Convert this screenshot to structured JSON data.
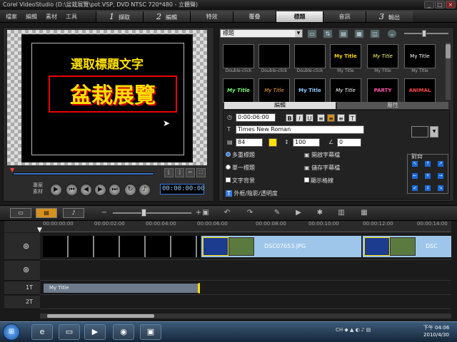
{
  "window": {
    "title": "Corel VideoStudio (D:\\盆栽展覽\\pot.VSP, DVD NTSC 720*480 - 立體聲)",
    "buttons": [
      "_",
      "□",
      "×"
    ]
  },
  "menu": [
    "檔案",
    "編輯",
    "素材",
    "工具"
  ],
  "steps": [
    {
      "num": "1",
      "label": "擷取"
    },
    {
      "num": "2",
      "label": "編輯"
    },
    {
      "num": "",
      "label": "特效"
    },
    {
      "num": "",
      "label": "覆疊"
    },
    {
      "num": "",
      "label": "標題"
    },
    {
      "num": "",
      "label": "音訊"
    },
    {
      "num": "3",
      "label": "輸出"
    }
  ],
  "active_step": "標題",
  "preview": {
    "title_line1": "選取標題文字",
    "title_line2": "盆栽展覽",
    "project_label": "專案\n素材",
    "timecode": "00:00:00:00"
  },
  "library": {
    "category": "標題",
    "thumbs": [
      {
        "text": "",
        "caption": "Double-click"
      },
      {
        "text": "",
        "caption": "Double-click"
      },
      {
        "text": "",
        "caption": "Double-click"
      },
      {
        "text": "My Title",
        "caption": "My Title"
      },
      {
        "text": "My Title",
        "caption": "My Title"
      },
      {
        "text": "My Title",
        "caption": "My Title"
      },
      {
        "text": "My Title",
        "caption": ""
      },
      {
        "text": "My Title",
        "caption": ""
      },
      {
        "text": "My Title",
        "caption": ""
      },
      {
        "text": "My Title",
        "caption": ""
      },
      {
        "text": "PARTY",
        "caption": ""
      },
      {
        "text": "ANIMAL",
        "caption": ""
      }
    ]
  },
  "edit": {
    "tab_edit": "編輯",
    "tab_attr": "屬性",
    "duration": "0:00:06:00",
    "font": "Times New Roman",
    "size": "84",
    "line_spacing": "100",
    "angle": "0",
    "radio_multi": "多重標題",
    "radio_single": "單一標題",
    "chk_bg": "文字背景",
    "open_file": "開啟字幕檔",
    "save_file": "儲存字幕檔",
    "grid": "顯示格線",
    "border": "外框/陰影/透明度",
    "align": "對齊",
    "color": "#ffe000"
  },
  "timeline": {
    "ticks": [
      "00:00:00:00",
      "00:00:02:00",
      "00:00:04:00",
      "00:00:06:00",
      "00:00:08:00",
      "00:00:10:00",
      "00:00:12:00",
      "00:00:14:00"
    ],
    "clip_name": "DSC07653.JPG",
    "clip_name2": "DSC",
    "title_clip": "My Title",
    "track_labels": [
      "",
      "",
      "1T",
      "2T"
    ]
  },
  "taskbar": {
    "lang": "CH",
    "time": "下午 04:06",
    "date": "2010/4/30"
  }
}
